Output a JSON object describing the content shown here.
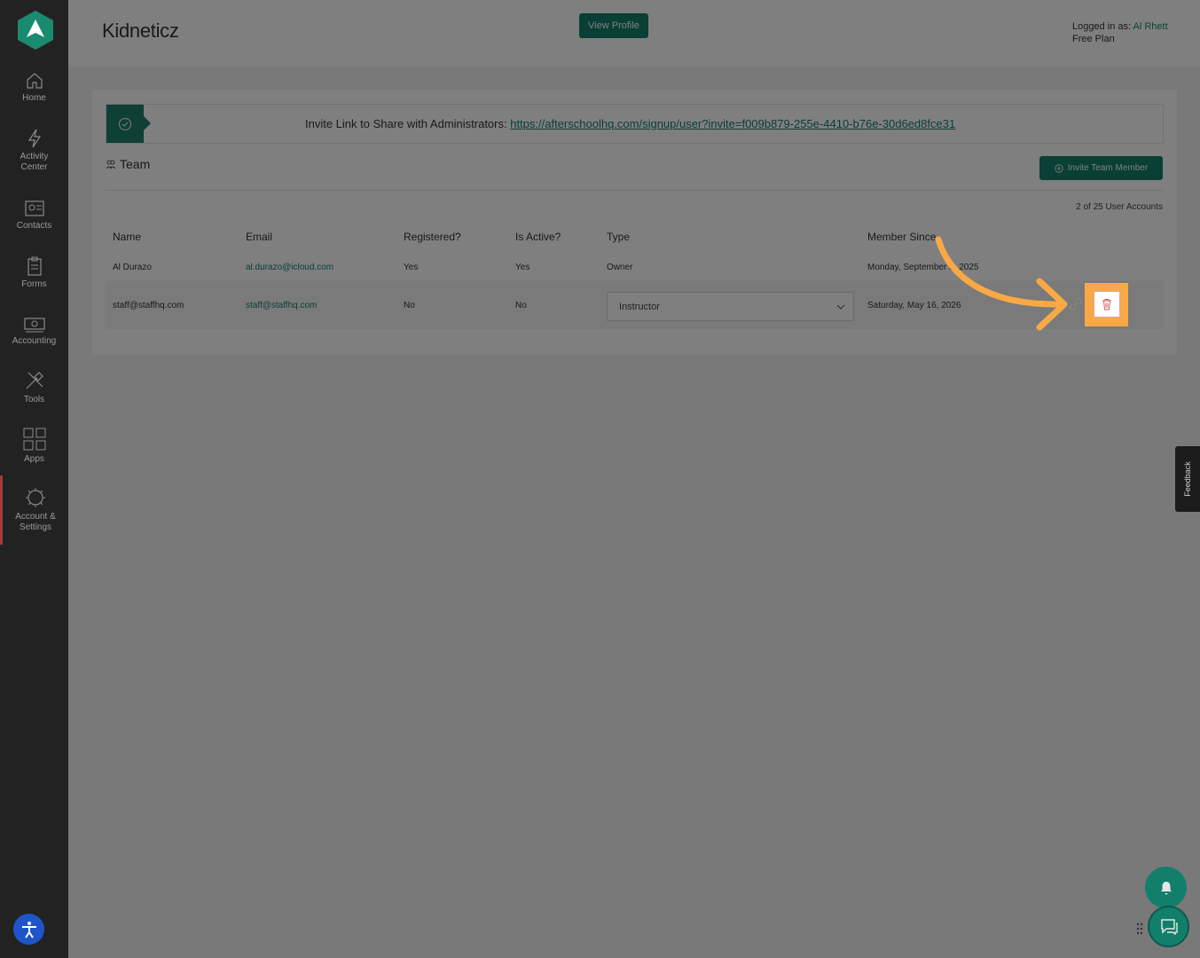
{
  "sidebar": {
    "items": [
      {
        "label": "Home",
        "icon": "home-icon"
      },
      {
        "label": "Activity\nCenter",
        "icon": "lightning-icon"
      },
      {
        "label": "Contacts",
        "icon": "contacts-icon"
      },
      {
        "label": "Forms",
        "icon": "clipboard-icon"
      },
      {
        "label": "Accounting",
        "icon": "cash-icon"
      },
      {
        "label": "Tools",
        "icon": "tools-icon"
      },
      {
        "label": "Apps",
        "icon": "grid-icon"
      },
      {
        "label": "Account &\nSettings",
        "icon": "gear-icon"
      }
    ],
    "accent": "#127f6a"
  },
  "header": {
    "title": "Kidneticz",
    "view_profile": "View Profile",
    "logged_in_prefix": "Logged in as:",
    "user": "Al Rhett",
    "plan": "Free Plan"
  },
  "invite": {
    "prefix": "Invite Link to Share with Administrators:",
    "link": "https://afterschoolhq.com/signup/user?invite=f009b879-255e-4410-b76e-30d6ed8fce31"
  },
  "team": {
    "title": "Team",
    "invite_button": "Invite Team Member",
    "count": "2 of 25 User Accounts",
    "columns": [
      "Name",
      "Email",
      "Registered?",
      "Is Active?",
      "Type",
      "Member Since"
    ],
    "rows": [
      {
        "name": "Al Durazo",
        "email": "al.durazo@icloud.com",
        "registered": "Yes",
        "active": "Yes",
        "type": "Owner",
        "since": "Monday, September 8, 2025"
      },
      {
        "name": "staff@staffhq.com",
        "email": "staff@staffhq.com",
        "registered": "No",
        "active": "No",
        "type": "Instructor",
        "since": "Saturday, May 16, 2026"
      }
    ]
  },
  "feedback": "Feedback"
}
